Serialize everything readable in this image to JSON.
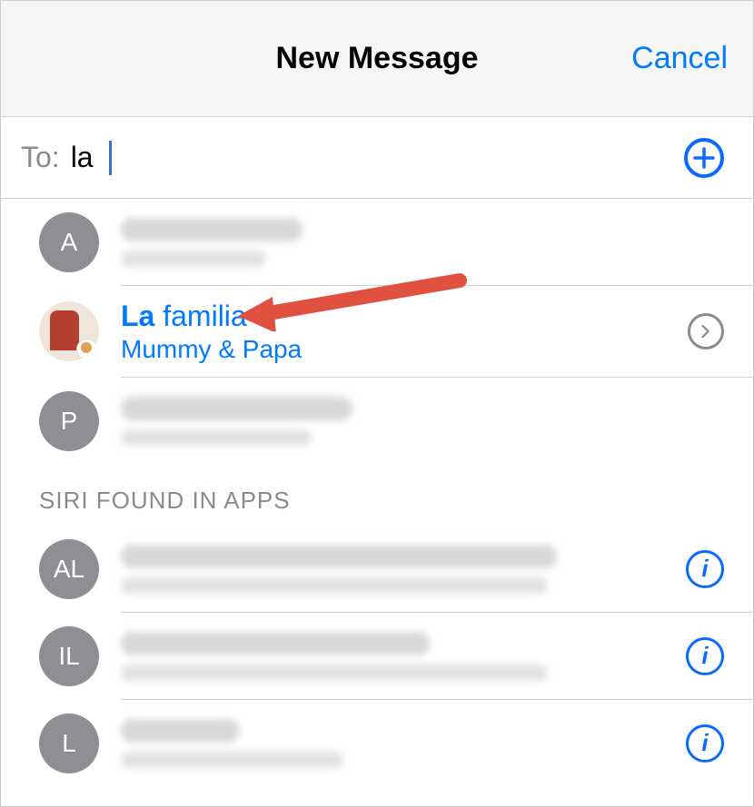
{
  "header": {
    "title": "New Message",
    "cancel_label": "Cancel"
  },
  "compose": {
    "to_label": "To:",
    "to_value": "la"
  },
  "suggestions": [
    {
      "avatar_initial": "A",
      "title_match": "",
      "title_rest": "",
      "subtitle": "",
      "blurred": true,
      "accessory": "none",
      "highlight": false
    },
    {
      "avatar_initial": "",
      "title_match": "La",
      "title_rest": " familia",
      "subtitle": "Mummy & Papa",
      "blurred": false,
      "accessory": "chevron",
      "highlight": true,
      "avatar_image": true
    },
    {
      "avatar_initial": "P",
      "title_match": "",
      "title_rest": "",
      "subtitle": "",
      "blurred": true,
      "accessory": "none",
      "highlight": false
    }
  ],
  "siri_section": {
    "header": "SIRI FOUND IN APPS",
    "items": [
      {
        "avatar_initial": "AL",
        "blurred": true,
        "accessory": "info"
      },
      {
        "avatar_initial": "IL",
        "blurred": true,
        "accessory": "info"
      },
      {
        "avatar_initial": "L",
        "blurred": true,
        "accessory": "info"
      }
    ]
  }
}
